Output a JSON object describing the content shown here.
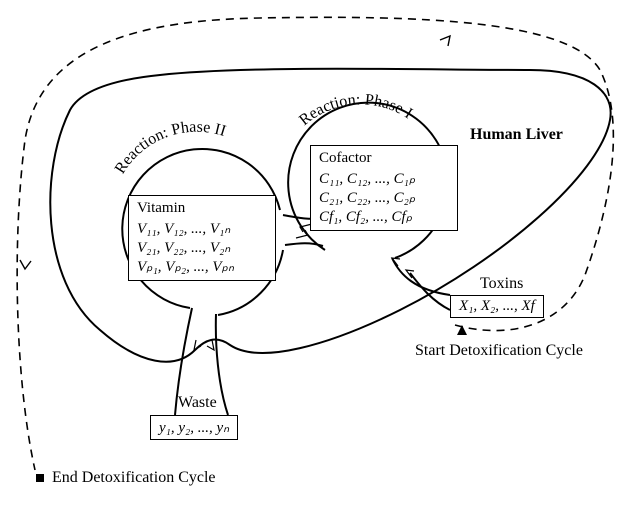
{
  "title": "Human Liver",
  "phase1": {
    "label": "Reaction: Phase I",
    "box_title": "Cofactor",
    "rows": [
      "C₁₁, C₁₂, ..., C₁ₚ",
      "C₂₁, C₂₂, ..., C₂ₚ",
      "Cf₁, Cf₂, ..., Cfₚ"
    ]
  },
  "phase2": {
    "label": "Reaction: Phase II",
    "box_title": "Vitamin",
    "rows": [
      "V₁₁, V₁₂, ..., V₁ₙ",
      "V₂₁, V₂₂, ..., V₂ₙ",
      "Vₚ₁, Vₚ₂, ..., Vₚₙ"
    ]
  },
  "toxins": {
    "title": "Toxins",
    "row": "X₁, X₂, ..., Xf"
  },
  "waste": {
    "title": "Waste",
    "row": "y₁, y₂, ..., yₙ"
  },
  "start_label": "Start Detoxification Cycle",
  "end_label": "End Detoxification Cycle"
}
